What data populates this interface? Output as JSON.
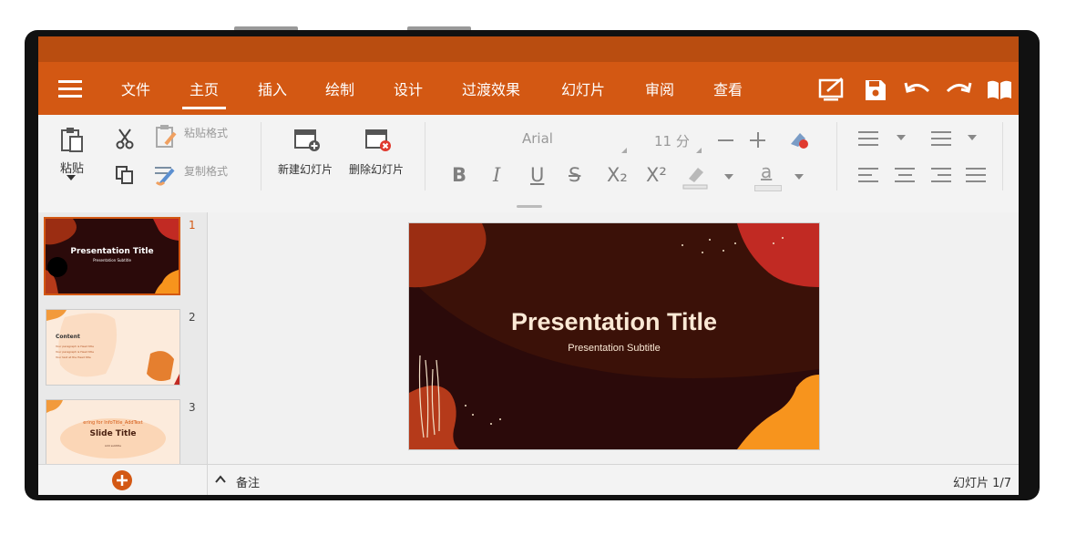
{
  "menu": {
    "items": [
      "文件",
      "主页",
      "插入",
      "绘制",
      "设计",
      "过渡效果",
      "幻灯片",
      "审阅",
      "查看"
    ],
    "active_index": 1
  },
  "ribbon": {
    "paste_label": "粘贴",
    "paste_format_label": "粘贴格式",
    "copy_format_label": "复制格式",
    "new_slide_label": "新建幻灯片",
    "delete_slide_label": "删除幻灯片",
    "font_name": "Arial",
    "font_size": "11 分",
    "bold": "B",
    "italic": "I",
    "underline": "U",
    "strike": "S",
    "subscript": "X₂",
    "superscript": "X²",
    "font_color_glyph": "a"
  },
  "slides": [
    {
      "number": "1",
      "title": "Presentation Title",
      "subtitle": "Presentation Subtitle"
    },
    {
      "number": "2",
      "title": "Content",
      "lines": [
        "Your paragraph is Head title",
        "Your paragraph is Head title",
        "Your text at the Head title"
      ]
    },
    {
      "number": "3",
      "kicker": "ering for InfoTitle_AddText",
      "title": "Slide Title",
      "caption": "Add subtitle"
    }
  ],
  "main_slide": {
    "title": "Presentation Title",
    "subtitle": "Presentation Subtitle"
  },
  "bottom": {
    "notes_label": "备注",
    "slide_indicator": "幻灯片 1/7"
  },
  "colors": {
    "accent": "#d35813",
    "accent_dark": "#b94d10",
    "slide_bg": "#2b0a0a"
  }
}
